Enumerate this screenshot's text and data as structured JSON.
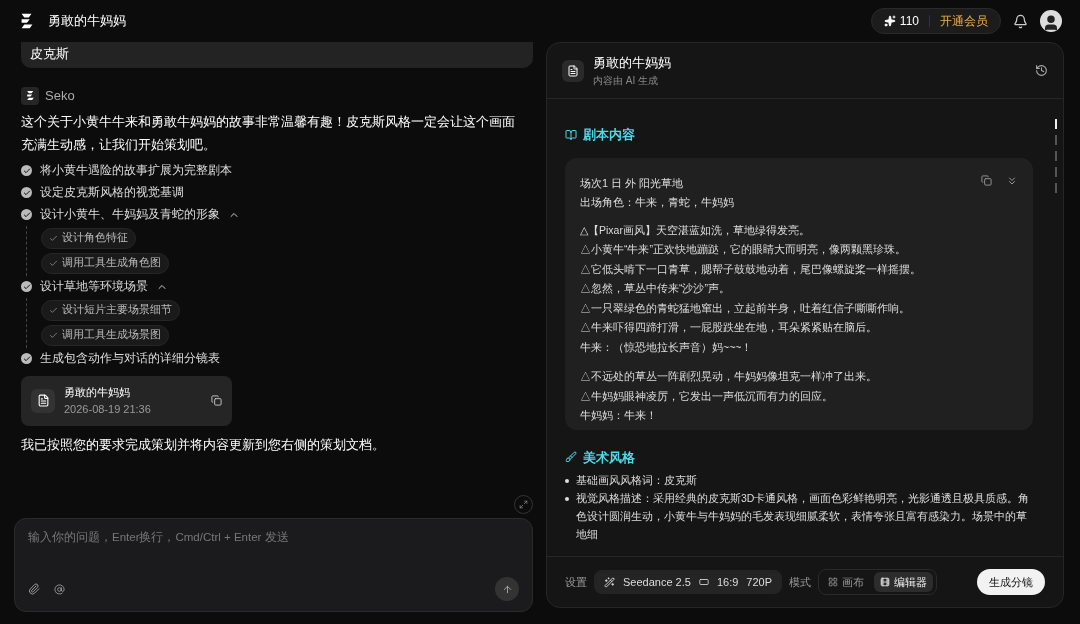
{
  "topbar": {
    "title": "勇敢的牛妈妈",
    "credits": "110",
    "vip": "开通会员"
  },
  "chat": {
    "user_message": "皮克斯",
    "assistant": "Seko",
    "intro": "这个关于小黄牛牛来和勇敢牛妈妈的故事非常温馨有趣！皮克斯风格一定会让这个画面充满生动感，让我们开始策划吧。",
    "steps": [
      {
        "label": "将小黄牛遇险的故事扩展为完整剧本"
      },
      {
        "label": "设定皮克斯风格的视觉基调"
      },
      {
        "label": "设计小黄牛、牛妈妈及青蛇的形象",
        "expanded": true,
        "children": [
          "设计角色特征",
          "调用工具生成角色图"
        ]
      },
      {
        "label": "设计草地等环境场景",
        "expanded": true,
        "children": [
          "设计短片主要场景细节",
          "调用工具生成场景图"
        ]
      },
      {
        "label": "生成包含动作与对话的详细分镜表"
      }
    ],
    "doc_card": {
      "title": "勇敢的牛妈妈",
      "time": "2026-08-19 21:36"
    },
    "closing": "我已按照您的要求完成策划并将内容更新到您右侧的策划文档。",
    "input": {
      "placeholder": "输入你的问题，Enter换行，Cmd/Ctrl + Enter 发送"
    }
  },
  "doc": {
    "title": "勇敢的牛妈妈",
    "subtitle": "内容由 AI 生成",
    "script_heading": "剧本内容",
    "scene": {
      "heading": "场次1 日 外 阳光草地",
      "cast": "出场角色：牛来，青蛇，牛妈妈",
      "paragraphs": [
        [
          "△【Pixar画风】天空湛蓝如洗，草地绿得发亮。",
          "△小黄牛“牛来”正欢快地蹦跶，它的眼睛大而明亮，像两颗黑珍珠。",
          "△它低头啃下一口青草，腮帮子鼓鼓地动着，尾巴像螺旋桨一样摇摆。",
          "△忽然，草丛中传来“沙沙”声。",
          "△一只翠绿色的青蛇猛地窜出，立起前半身，吐着红信子嘶嘶作响。",
          "△牛来吓得四蹄打滑，一屁股跌坐在地，耳朵紧紧贴在脑后。",
          "牛来：（惊恐地拉长声音）妈~~~！"
        ],
        [
          "△不远处的草丛一阵剧烈晃动，牛妈妈像坦克一样冲了出来。",
          "△牛妈妈眼神凌厉，它发出一声低沉而有力的回应。",
          "牛妈妈：牛来！"
        ]
      ]
    },
    "art_heading": "美术风格",
    "art_items": [
      "基础画风风格词：皮克斯",
      "视觉风格描述：采用经典的皮克斯3D卡通风格，画面色彩鲜艳明亮，光影通透且极具质感。角色设计圆润生动，小黄牛与牛妈妈的毛发表现细腻柔软，表情夸张且富有感染力。场景中的草地细"
    ],
    "footer": {
      "settings_label": "设置",
      "model": "Seedance 2.5",
      "ratio": "16:9",
      "resolution": "720P",
      "mode_label": "模式",
      "modes": [
        {
          "label": "画布",
          "selected": false
        },
        {
          "label": "编辑器",
          "selected": true
        }
      ],
      "generate": "生成分镜"
    }
  }
}
